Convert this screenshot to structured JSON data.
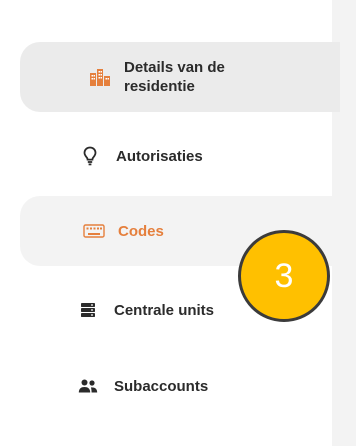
{
  "sidebar": {
    "items": [
      {
        "label": "Details van de residentie",
        "icon": "buildings-icon",
        "state": "active"
      },
      {
        "label": "Autorisaties",
        "icon": "lightbulb-icon",
        "state": "normal"
      },
      {
        "label": "Codes",
        "icon": "keyboard-icon",
        "state": "hover"
      },
      {
        "label": "Centrale units",
        "icon": "server-icon",
        "state": "normal"
      },
      {
        "label": "Subaccounts",
        "icon": "users-icon",
        "state": "normal"
      }
    ]
  },
  "annotation": {
    "step_number": "3"
  },
  "colors": {
    "accent": "#e57f3c",
    "badge": "#ffc000",
    "active_bg": "#ebebeb",
    "text": "#2b2b2b"
  }
}
